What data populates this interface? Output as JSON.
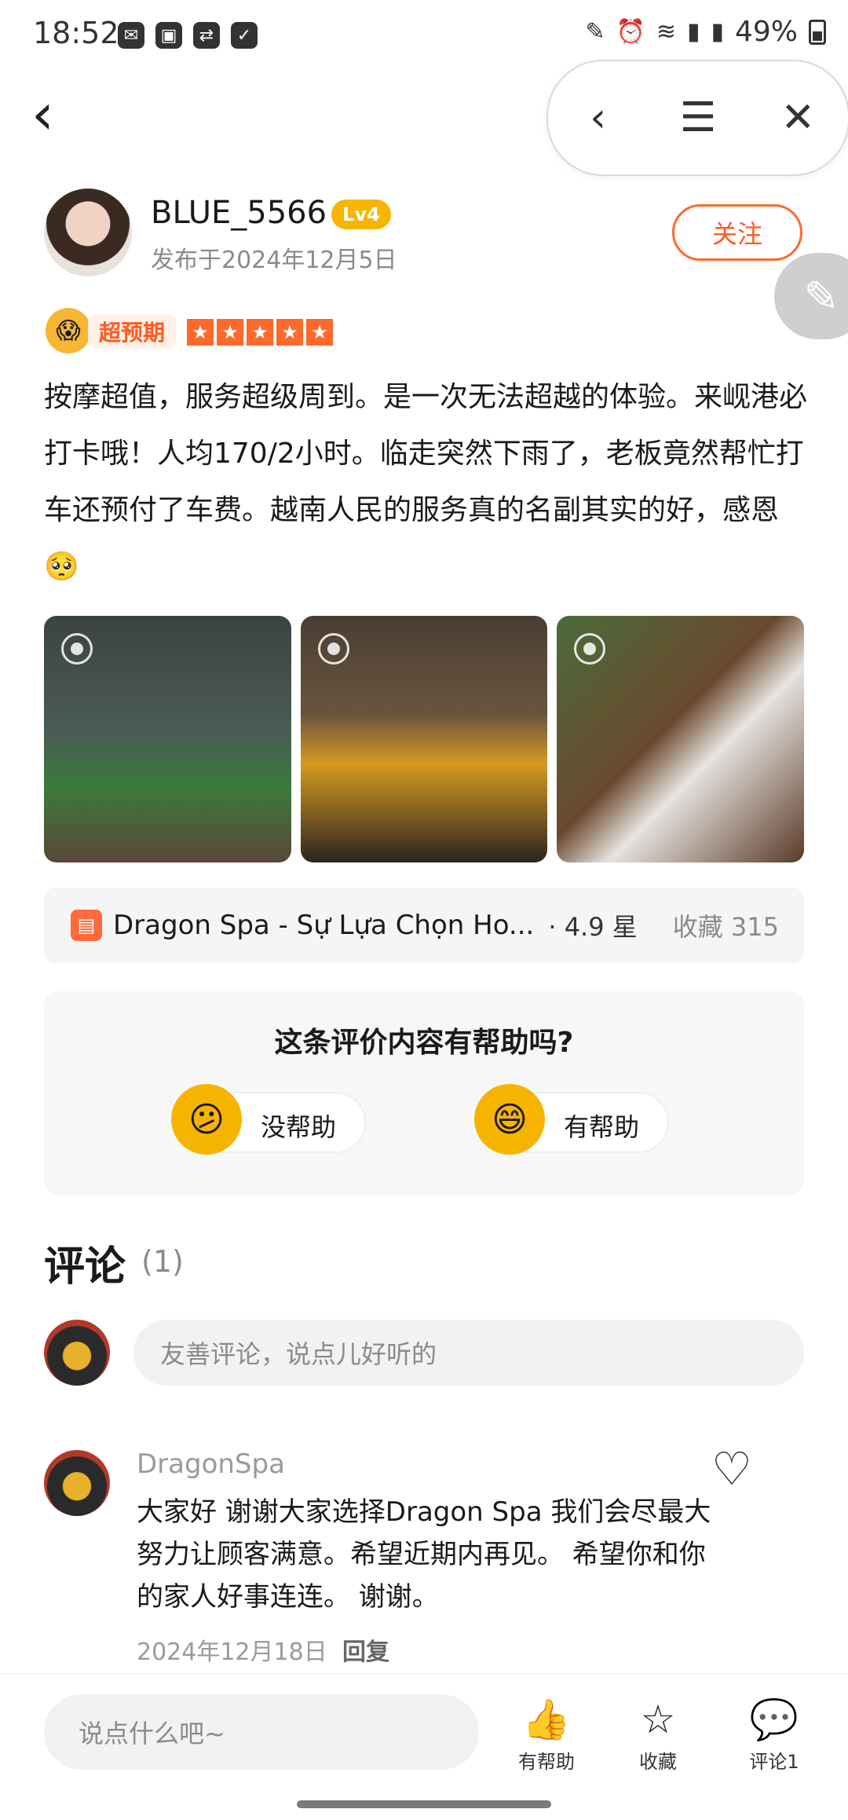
{
  "status_bar": {
    "time": "18:52",
    "battery": "49%"
  },
  "nav": {
    "back_icon": "back-icon",
    "capsule": [
      "chevron-left-icon",
      "document-icon",
      "close-icon"
    ]
  },
  "author": {
    "name": "BLUE_5566",
    "level": "Lv4",
    "date": "发布于2024年12月5日",
    "follow": "关注"
  },
  "rating": {
    "badge": "超预期",
    "stars": 5
  },
  "review_text": "按摩超值，服务超级周到。是一次无法超越的体验。来岘港必打卡哦！人均170/2小时。临走突然下雨了，老板竟然帮忙打车还预付了车费。越南人民的服务真的名副其实的好，感恩🥺",
  "poi": {
    "name": "Dragon Spa - Sự Lựa Chọn Ho...",
    "rating": "· 4.9 星",
    "favorites": "收藏 315"
  },
  "helpful_card": {
    "question": "这条评价内容有帮助吗?",
    "no": "没帮助",
    "yes": "有帮助"
  },
  "comments": {
    "title": "评论",
    "count": "(1)",
    "input_placeholder": "友善评论，说点儿好听的",
    "items": [
      {
        "author": "DragonSpa",
        "text": "大家好 谢谢大家选择Dragon Spa 我们会尽最大努力让顾客满意。希望近期内再见。 希望你和你的家人好事连连。 谢谢。",
        "date": "2024年12月18日",
        "reply": "回复"
      }
    ]
  },
  "bottom_bar": {
    "input_placeholder": "说点什么吧~",
    "helpful": "有帮助",
    "favorite": "收藏",
    "comment": "评论1"
  }
}
